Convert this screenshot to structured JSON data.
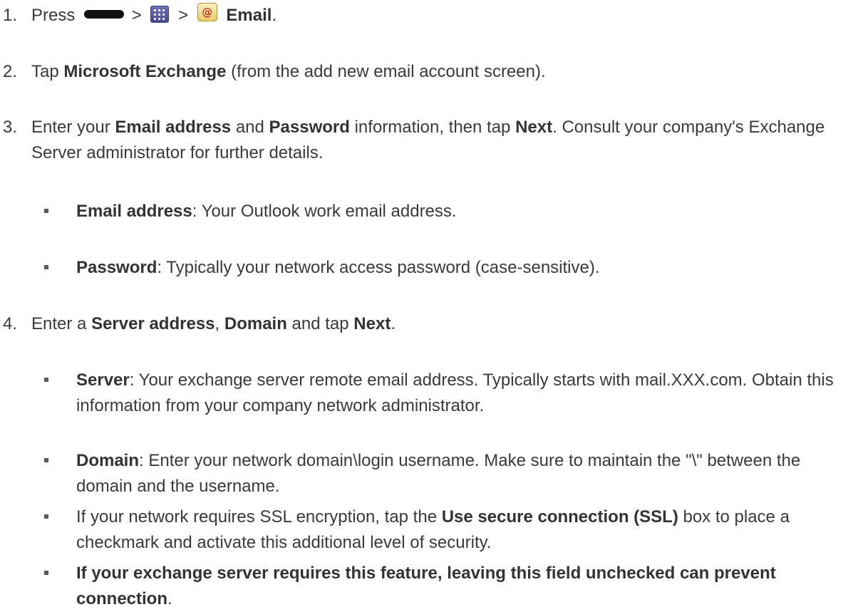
{
  "steps": [
    {
      "number": "1.",
      "parts": {
        "t1": "Press",
        "sep1": ">",
        "sep2": ">",
        "b1": "Email",
        "t2": "."
      },
      "icons": [
        "home-key-icon",
        "apps-grid-icon",
        "email-app-icon"
      ]
    },
    {
      "number": "2.",
      "parts": {
        "t1": "Tap",
        "b1": "Microsoft Exchange",
        "t2": "(from the add new email account screen)."
      }
    },
    {
      "number": "3.",
      "parts": {
        "t1": "Enter your",
        "b1": "Email address",
        "t2": "and",
        "b2": "Password",
        "t3": "information, then tap",
        "b3": "Next",
        "t4": ". Consult your company's Exchange Server administrator for further details."
      },
      "bullets": [
        {
          "b": "Email address",
          "t": ": Your Outlook work email address."
        },
        {
          "b": "Password",
          "t": ": Typically your network access password (case-sensitive)."
        }
      ]
    },
    {
      "number": "4.",
      "parts": {
        "t1": "Enter a",
        "b1": "Server address",
        "t2": ",",
        "b2": "Domain",
        "t3": "and tap",
        "b3": "Next",
        "t4": "."
      },
      "bullets": [
        {
          "b": "Server",
          "t": ": Your exchange server remote email address. Typically starts with mail.XXX.com. Obtain this information from your company network administrator."
        },
        {
          "b": "Domain",
          "t": ": Enter your network domain\\login username. Make sure to maintain the \"\\\" between the domain and the username."
        },
        {
          "t1": "If your network requires SSL encryption, tap the",
          "b": "Use secure connection (SSL)",
          "t2": "box to place a checkmark and activate this additional level of security."
        },
        {
          "b": "If your exchange server requires this feature, leaving this field unchecked can prevent connection",
          "t": "."
        }
      ]
    }
  ],
  "colors": {
    "text": "#3a3a3a",
    "bold_text": "#333333",
    "bullet": "#5a5a5a",
    "home_key": "#111111",
    "apps_icon": "#4a4a92",
    "email_icon": "#e9c96a"
  }
}
